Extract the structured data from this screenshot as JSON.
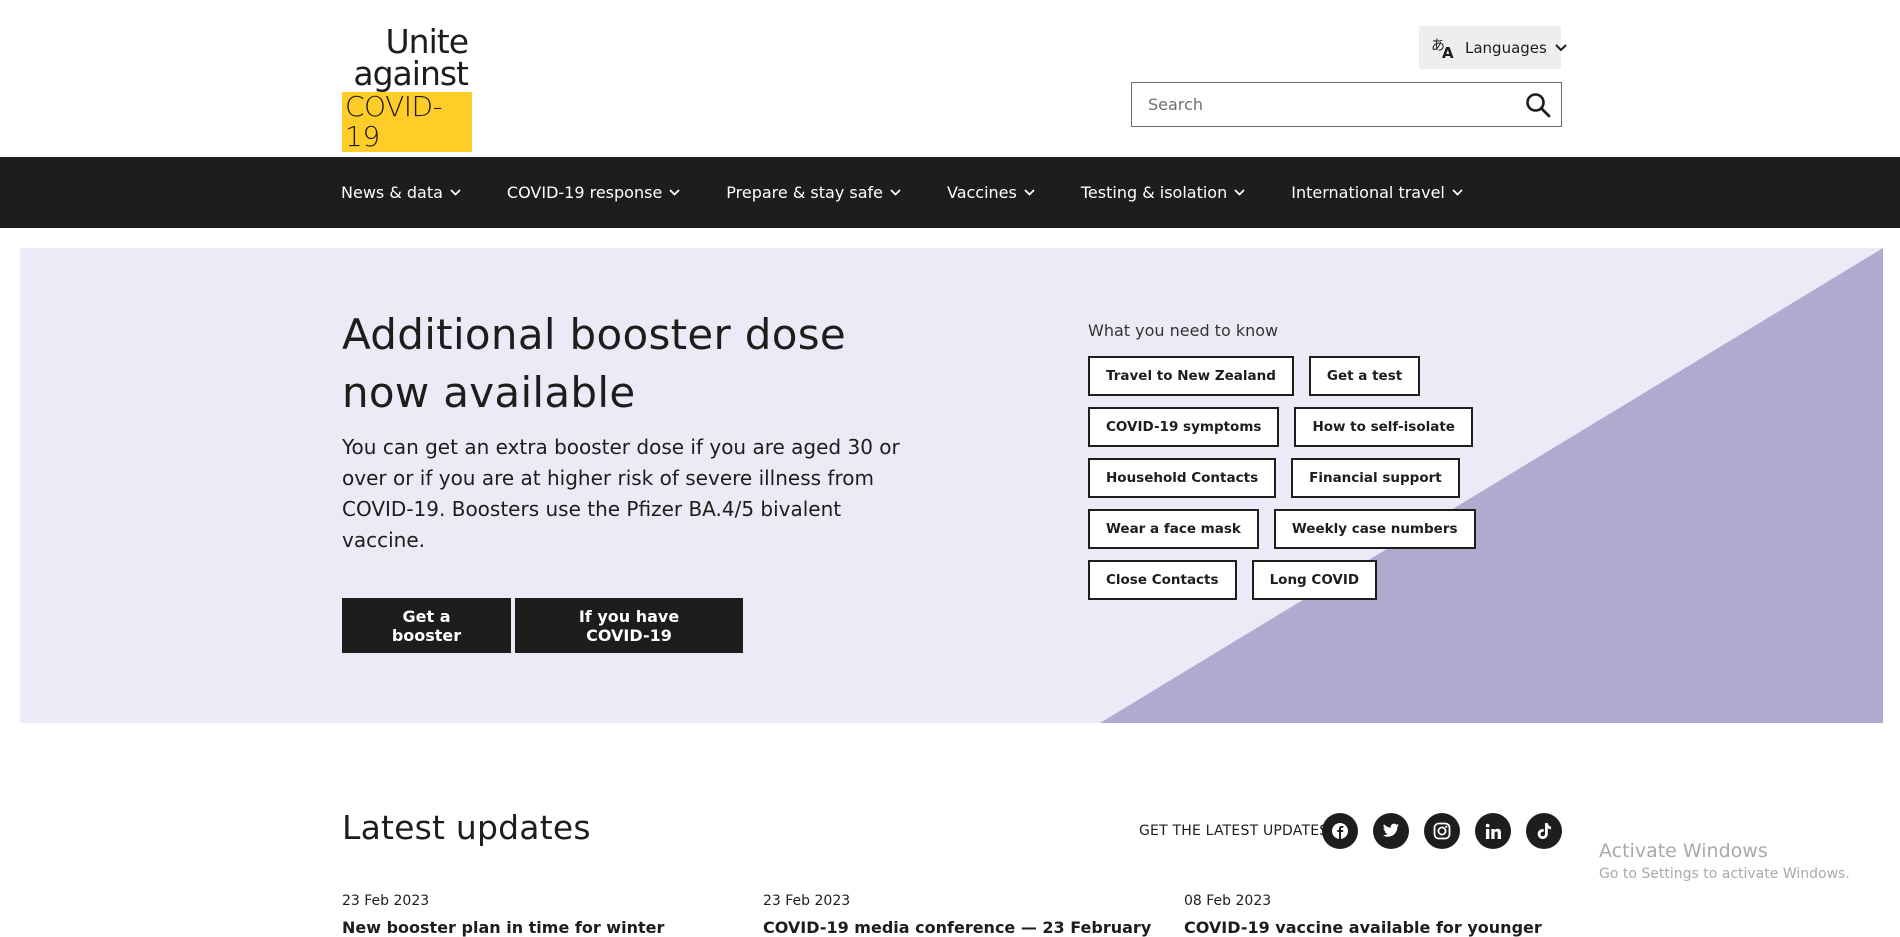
{
  "header": {
    "logo": {
      "line1": "Unite",
      "line2": "against",
      "line3": "COVID-19"
    },
    "languages_label": "Languages",
    "search_placeholder": "Search"
  },
  "nav": {
    "items": [
      {
        "label": "News & data"
      },
      {
        "label": "COVID-19 response"
      },
      {
        "label": "Prepare & stay safe"
      },
      {
        "label": "Vaccines"
      },
      {
        "label": "Testing & isolation"
      },
      {
        "label": "International travel"
      }
    ]
  },
  "hero": {
    "title": "Additional booster dose now available",
    "body": "You can get an extra booster dose if you are aged 30 or over or if you are at higher risk of severe illness from COVID-19. Boosters use the Pfizer BA.4/5 bivalent vaccine.",
    "primary_button": "Get a booster",
    "secondary_button": "If you have COVID-19",
    "colors": {
      "background": "#ebebf7",
      "triangle": "#aeaad0"
    }
  },
  "what_you_need": {
    "label": "What you need to know",
    "rows": [
      [
        "Travel to New Zealand",
        "Get a test"
      ],
      [
        "COVID-19 symptoms",
        "How to self-isolate"
      ],
      [
        "Household Contacts",
        "Financial support"
      ],
      [
        "Wear a face mask",
        "Weekly case numbers"
      ],
      [
        "Close Contacts",
        "Long COVID"
      ]
    ]
  },
  "latest_updates": {
    "title": "Latest updates",
    "social_label": "GET THE LATEST UPDATES",
    "social_icons": [
      "facebook-icon",
      "twitter-icon",
      "instagram-icon",
      "linkedin-icon",
      "tiktok-icon"
    ],
    "news": [
      {
        "date": "23 Feb 2023",
        "title": "New booster plan in time for winter"
      },
      {
        "date": "23 Feb 2023",
        "title": "COVID-19 media conference — 23 February"
      },
      {
        "date": "08 Feb 2023",
        "title": "COVID-19 vaccine available for younger"
      }
    ]
  },
  "watermark": {
    "line1": "Activate Windows",
    "line2": "Go to Settings to activate Windows."
  },
  "colors": {
    "dark": "#1f1c1c",
    "logo_yellow": "#ffcc28"
  }
}
